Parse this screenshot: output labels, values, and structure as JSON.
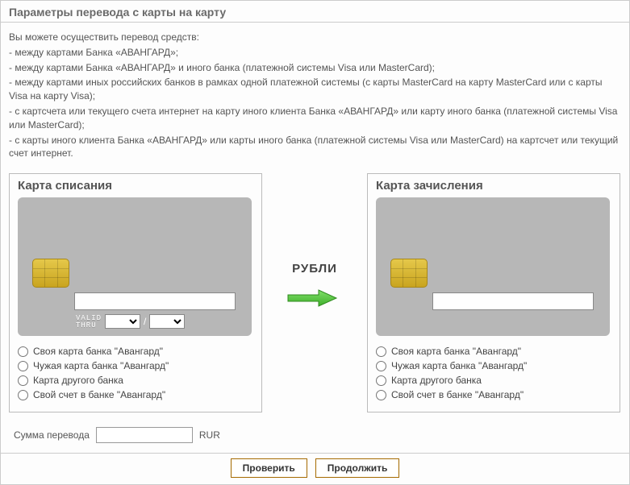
{
  "section_title": "Параметры перевода с карты на карту",
  "intro": {
    "line0": "Вы можете осуществить перевод средств:",
    "line1": "- между картами Банка «АВАНГАРД»;",
    "line2": "- между картами Банка «АВАНГАРД» и иного банка (платежной системы Visa или MasterCard);",
    "line3": "- между картами иных российских банков в рамках одной платежной системы (с карты MasterCard на карту MasterCard или с карты Visa на карту Visa);",
    "line4": "- с картсчета или текущего счета интернет на карту иного клиента Банка «АВАНГАРД» или карту иного банка (платежной системы Visa или MasterCard);",
    "line5": "- с карты иного клиента Банка «АВАНГАРД» или карты иного банка (платежной системы Visa или MasterCard) на картсчет или текущий счет интернет."
  },
  "left_card": {
    "title": "Карта списания",
    "number_value": "",
    "valid_thru": "VALID\nTHRU",
    "month_value": "",
    "year_value": "",
    "radios": {
      "r0": "Своя карта банка \"Авангард\"",
      "r1": "Чужая карта банка \"Авангард\"",
      "r2": "Карта другого банка",
      "r3": "Свой счет в банке \"Авангард\""
    }
  },
  "middle": {
    "currency": "РУБЛИ"
  },
  "right_card": {
    "title": "Карта зачисления",
    "number_value": "",
    "radios": {
      "r0": "Своя карта банка \"Авангард\"",
      "r1": "Чужая карта банка \"Авангард\"",
      "r2": "Карта другого банка",
      "r3": "Свой счет в банке \"Авангард\""
    }
  },
  "amount": {
    "label": "Сумма перевода",
    "value": "",
    "currency": "RUR"
  },
  "buttons": {
    "check": "Проверить",
    "continue": "Продолжить"
  }
}
